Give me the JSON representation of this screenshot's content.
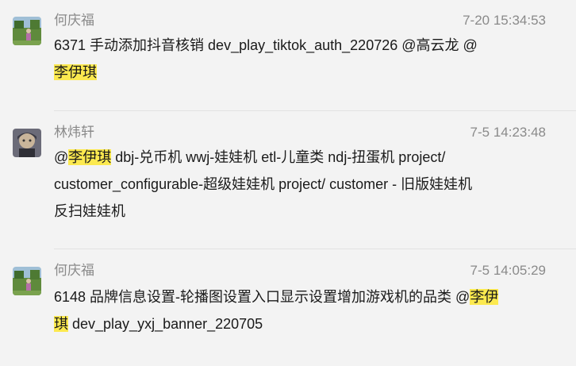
{
  "messages": [
    {
      "sender": "何庆福",
      "time": "7-20 15:34:53",
      "lines": [
        [
          "6371 手动添加抖音核销 dev_play_tiktok_auth_220726 @高云龙 @"
        ],
        [
          "",
          "李伊琪"
        ]
      ]
    },
    {
      "sender": "林炜轩",
      "time": "7-5 14:23:48",
      "lines": [
        [
          "@",
          "李伊琪",
          " dbj-兑币机 wwj-娃娃机 etl-儿童类 ndj-扭蛋机 project/"
        ],
        [
          "customer_configurable-超级娃娃机 project/ customer - 旧版娃娃机"
        ],
        [
          " 反扫娃娃机"
        ]
      ]
    },
    {
      "sender": "何庆福",
      "time": "7-5 14:05:29",
      "lines": [
        [
          "6148 品牌信息设置-轮播图设置入口显示设置增加游戏机的品类 @",
          "李伊"
        ],
        [
          "",
          "琪",
          " dev_play_yxj_banner_220705"
        ]
      ]
    }
  ]
}
